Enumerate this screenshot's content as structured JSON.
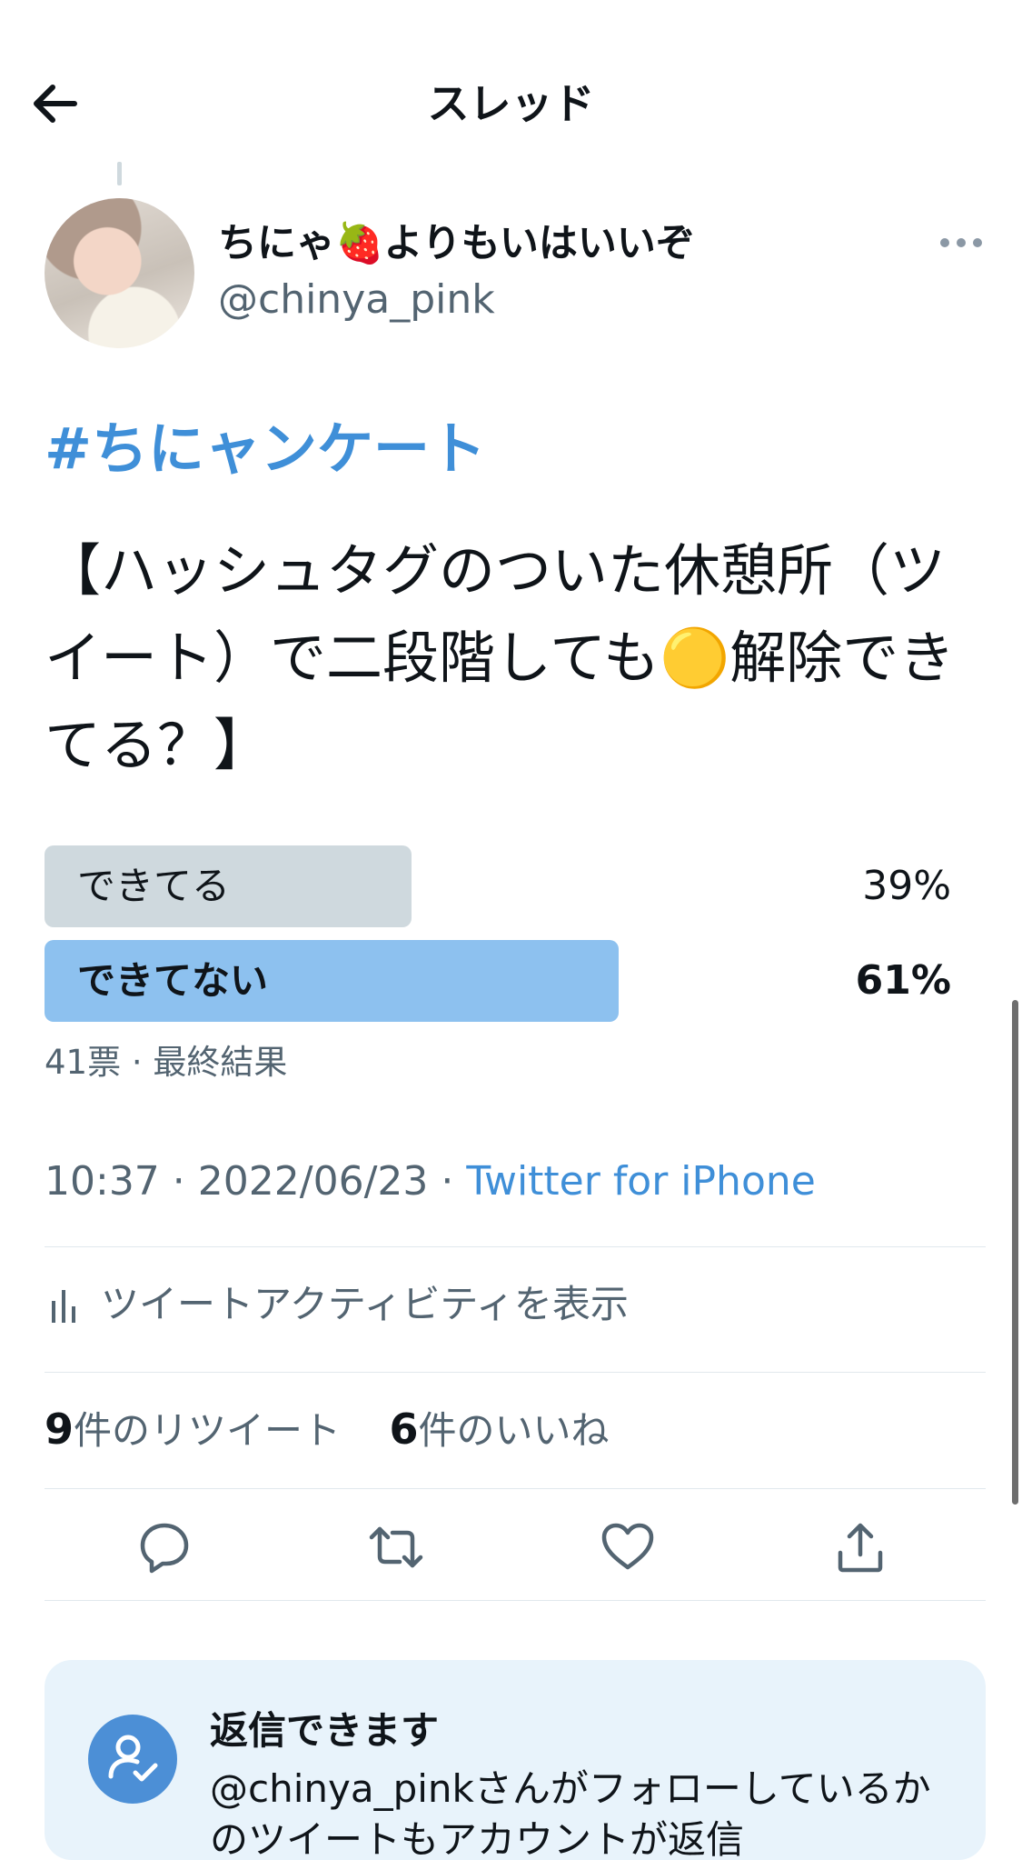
{
  "header": {
    "title": "スレッド",
    "back_icon": "arrow-left-icon"
  },
  "author": {
    "display_name": "ちにゃ🍓よりもいはいいぞ",
    "handle": "@chinya_pink"
  },
  "tweet": {
    "hashtag": "#ちにャンケート",
    "text": "【ハッシュタグのついた休憩所（ツイート）で二段階しても🟡解除できてる？】"
  },
  "poll": {
    "options": [
      {
        "label": "できてる",
        "percent_text": "39%",
        "percent": 39,
        "winner": false
      },
      {
        "label": "できてない",
        "percent_text": "61%",
        "percent": 61,
        "winner": true
      }
    ],
    "meta": "41票 · 最終結果"
  },
  "meta": {
    "time": "10:37",
    "date": "2022/06/23",
    "separator": " · ",
    "source": "Twitter for iPhone"
  },
  "activity": {
    "label": "ツイートアクティビティを表示"
  },
  "counts": {
    "retweets_number": "9",
    "retweets_label": "件のリツイート",
    "likes_number": "6",
    "likes_label": "件のいいね"
  },
  "reply_restriction": {
    "title": "返信できます",
    "body": "@chinya_pinkさんがフォローしているかのツイートもアカウントが返信"
  },
  "colors": {
    "accent": "#3f8fd8",
    "poll_winner": "#8dc1ef",
    "poll_other": "#cfd9de",
    "muted_text": "#536471",
    "card_bg": "#e8f3fb"
  }
}
